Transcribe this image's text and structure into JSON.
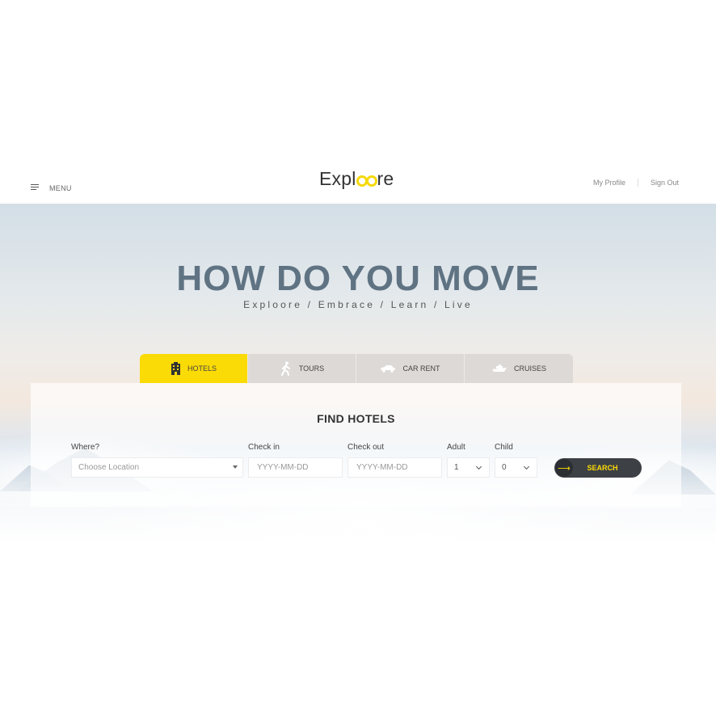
{
  "header": {
    "menu_label": "MENU",
    "logo": {
      "before": "Expl",
      "after": "re"
    },
    "links": [
      "My Profile",
      "Sign Out"
    ]
  },
  "hero": {
    "title": "HOW DO YOU MOVE",
    "subtitle": "Exploore / Embrace / Learn / Live"
  },
  "tabs": [
    {
      "label": "HOTELS",
      "icon": "hotel-icon",
      "active": true
    },
    {
      "label": "TOURS",
      "icon": "hiker-icon",
      "active": false
    },
    {
      "label": "CAR RENT",
      "icon": "car-icon",
      "active": false
    },
    {
      "label": "CRUISES",
      "icon": "ship-icon",
      "active": false
    }
  ],
  "search": {
    "title": "FIND HOTELS",
    "where": {
      "label": "Where?",
      "placeholder": "Choose Location"
    },
    "check_in": {
      "label": "Check in",
      "placeholder": "YYYY-MM-DD"
    },
    "check_out": {
      "label": "Check out",
      "placeholder": "YYYY-MM-DD"
    },
    "adult": {
      "label": "Adult",
      "value": "1"
    },
    "child": {
      "label": "Child",
      "value": "0"
    },
    "button_label": "SEARCH"
  },
  "colors": {
    "accent": "#fbdb05",
    "dark": "#3d4045",
    "title": "#5f7383"
  }
}
